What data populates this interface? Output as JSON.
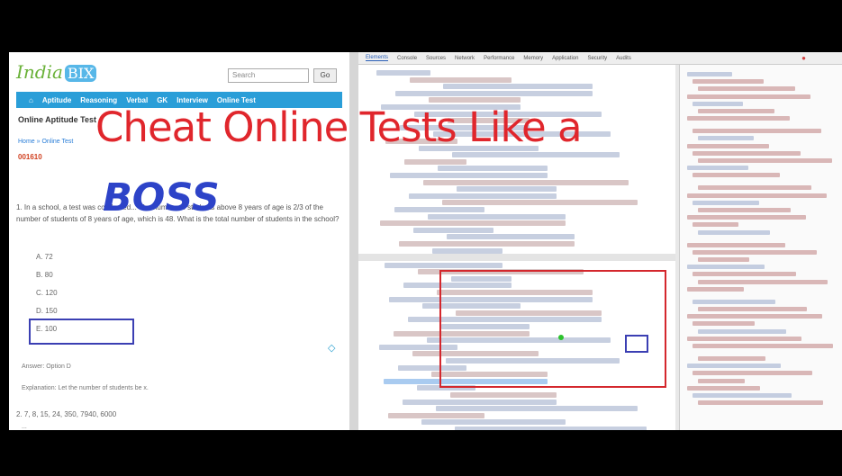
{
  "overlay": {
    "headline": "Cheat Online Tests Like a",
    "boss": "BOSS"
  },
  "quiz_page": {
    "logo_text": "India",
    "logo_badge": "BIX",
    "search_placeholder": "Search",
    "search_button": "Go",
    "nav_items": [
      "⌂",
      "Aptitude",
      "Reasoning",
      "Verbal",
      "GK",
      "Interview",
      "Online Test"
    ],
    "page_heading": "Online Aptitude Test",
    "breadcrumb": "Home » Online Test",
    "question_id": "001610",
    "question_text": "1. In a school, a test was conducted... The number of students above 8 years of age is 2/3 of the number of students of 8 years of age, which is 48. What is the total number of students in the school?",
    "options": [
      "A.  72",
      "B.  80",
      "C.  120",
      "D.  150",
      "E.  100"
    ],
    "answer_text": "Answer: Option D",
    "explanation_text": "Explanation: Let the number of students be x.",
    "question2": "2. 7, 8, 15, 24, 350, 7940, 6000",
    "question2_sub": "..."
  },
  "devtools": {
    "tabs": [
      "Elements",
      "Console",
      "Sources",
      "Network",
      "Performance",
      "Memory",
      "Application",
      "Security",
      "Audits"
    ],
    "active_tab": "Elements",
    "warning_icon": "error-icon"
  },
  "colors": {
    "headline": "#e0262c",
    "boss": "#2d43c8",
    "highlight_red": "#d4272d",
    "highlight_blue": "#3b3fb3",
    "nav": "#2a9ed8"
  }
}
